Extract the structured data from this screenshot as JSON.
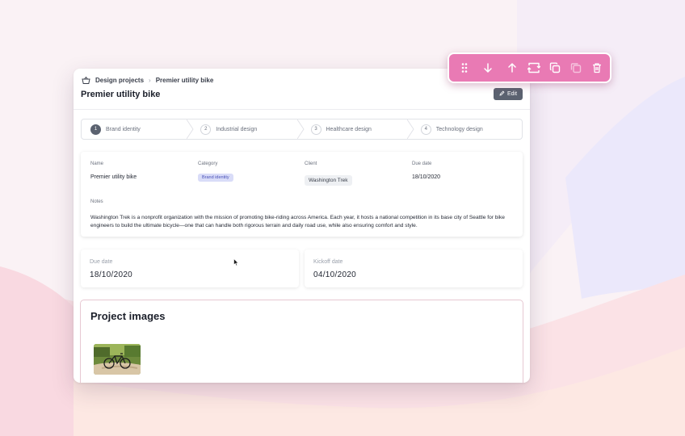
{
  "breadcrumb": {
    "root": "Design projects",
    "current": "Premier utility bike"
  },
  "page": {
    "title": "Premier utility bike",
    "edit_label": "Edit"
  },
  "steps": [
    {
      "num": "1",
      "label": "Brand identity",
      "active": true
    },
    {
      "num": "2",
      "label": "Industrial design",
      "active": false
    },
    {
      "num": "3",
      "label": "Healthcare design",
      "active": false
    },
    {
      "num": "4",
      "label": "Technology design",
      "active": false
    }
  ],
  "details": {
    "name_label": "Name",
    "name_value": "Premier utility bike",
    "category_label": "Category",
    "category_value": "Brand identity",
    "client_label": "Client",
    "client_value": "Washington Trek",
    "due_label": "Due date",
    "due_value": "18/10/2020",
    "notes_label": "Notes",
    "notes_value": "Washington Trek is a nonprofit organization with the mission of promoting bike-riding across America. Each year, it hosts a national competition in its base city of Seattle for bike engineers to build the ultimate bicycle—one that can handle both rigorous terrain and daily road use, while also ensuring comfort and style."
  },
  "dates": {
    "due_label": "Due date",
    "due_value": "18/10/2020",
    "kickoff_label": "Kickoff date",
    "kickoff_value": "04/10/2020"
  },
  "images": {
    "title": "Project images"
  },
  "toolbar": {
    "buttons": [
      "drag-handle-icon",
      "arrow-down-icon",
      "arrow-up-icon",
      "swap-icon",
      "duplicate-icon",
      "folder-icon",
      "trash-icon"
    ]
  },
  "colors": {
    "toolbar_bg": "#e97ab4",
    "edit_button_bg": "#5b6270",
    "category_badge_bg": "#d9dcf8",
    "background": "#faf2f5"
  }
}
